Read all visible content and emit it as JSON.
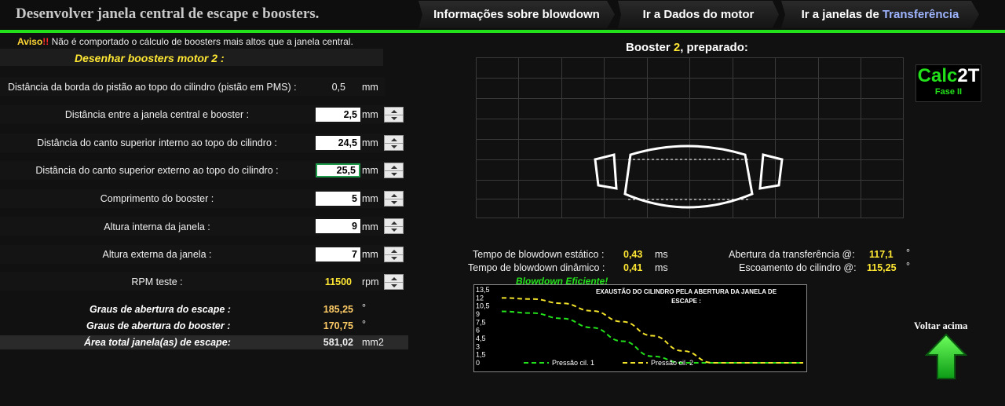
{
  "header": {
    "title": "Desenvolver janela central de escape e boosters",
    "title_dot": ".",
    "nav": [
      {
        "label": "Informações sobre blowdown",
        "highlight": ""
      },
      {
        "label": "Ir a Dados do motor",
        "highlight": ""
      },
      {
        "label": "Ir a janelas de",
        "highlight": "Transferência"
      }
    ]
  },
  "aviso": {
    "word": "Aviso",
    "marks": "!!",
    "text": " Não é comportado o cálculo de boosters mais altos que a janela central."
  },
  "section_title": "Desenhar boosters motor 2 :",
  "fields": {
    "piston_dist": {
      "label": "Distância da borda do pistão ao topo do cilindro (pistão em PMS) :",
      "value": "0,5",
      "unit": "mm"
    },
    "central_booster": {
      "label": "Distância entre a janela central e booster :",
      "value": "2,5",
      "unit": "mm"
    },
    "inner_corner": {
      "label": "Distância do canto superior interno ao topo do cilindro :",
      "value": "24,5",
      "unit": "mm"
    },
    "outer_corner": {
      "label": "Distância do canto superior externo ao topo do cilindro :",
      "value": "25,5",
      "unit": "mm"
    },
    "booster_length": {
      "label": "Comprimento do booster :",
      "value": "5",
      "unit": "mm"
    },
    "inner_height": {
      "label": "Altura interna da janela :",
      "value": "9",
      "unit": "mm"
    },
    "outer_height": {
      "label": "Altura externa da janela :",
      "value": "7",
      "unit": "mm"
    },
    "rpm": {
      "label": "RPM teste :",
      "value": "11500",
      "unit": "rpm"
    }
  },
  "results": {
    "escape_deg": {
      "label": "Graus de abertura do escape :",
      "value": "185,25",
      "unit": "°"
    },
    "booster_deg": {
      "label": "Graus de abertura do booster :",
      "value": "170,75",
      "unit": "°"
    },
    "area": {
      "label": "Área total janela(as) de escape:",
      "value": "581,02",
      "unit": "mm2"
    }
  },
  "booster": {
    "prefix": "Booster ",
    "number": "2",
    "suffix": ", preparado:"
  },
  "logo": {
    "main": "Calc",
    "accent": "2T",
    "sub": "Fase II"
  },
  "stats": {
    "static": {
      "label": "Tempo de blowdown estático :",
      "value": "0,43",
      "unit": "ms"
    },
    "dynamic": {
      "label": "Tempo de blowdown dinâmico :",
      "value": "0,41",
      "unit": "ms"
    },
    "transfer": {
      "label": "Abertura da transferência @:",
      "value": "117,1",
      "unit": "°"
    },
    "flow": {
      "label": "Escoamento do cilindro @:",
      "value": "115,25",
      "unit": "°"
    }
  },
  "efficiency": "Blowdown Eficiente!",
  "back_label": "Voltar acima",
  "colors": {
    "accent_green": "#22e01a",
    "value_yellow": "#ffe733",
    "series1": "#22e01a",
    "series2": "#f2e22a"
  },
  "chart_data": {
    "type": "line",
    "title": "EXAUSTÃO DO CILINDRO PELA ABERTURA DA JANELA DE ESCAPE :",
    "xlabel": "",
    "ylabel": "",
    "ylim": [
      0,
      13.5
    ],
    "yticks": [
      "13,5",
      "12",
      "10,5",
      "9",
      "7,5",
      "6",
      "4,5",
      "3",
      "1,5",
      "0"
    ],
    "x": [
      0,
      1,
      2,
      3,
      4,
      5,
      6,
      7,
      8,
      9,
      10
    ],
    "series": [
      {
        "name": "Pressão cil. 1",
        "values": [
          9.5,
          9.2,
          8.2,
          6.5,
          4.0,
          1.2,
          0,
          0,
          0,
          0,
          0
        ]
      },
      {
        "name": "Pressão cil. 2",
        "values": [
          12.0,
          11.8,
          11.0,
          9.6,
          7.6,
          5.0,
          2.2,
          0,
          0,
          0,
          0
        ]
      }
    ],
    "legend": "bottom",
    "grid": false
  }
}
